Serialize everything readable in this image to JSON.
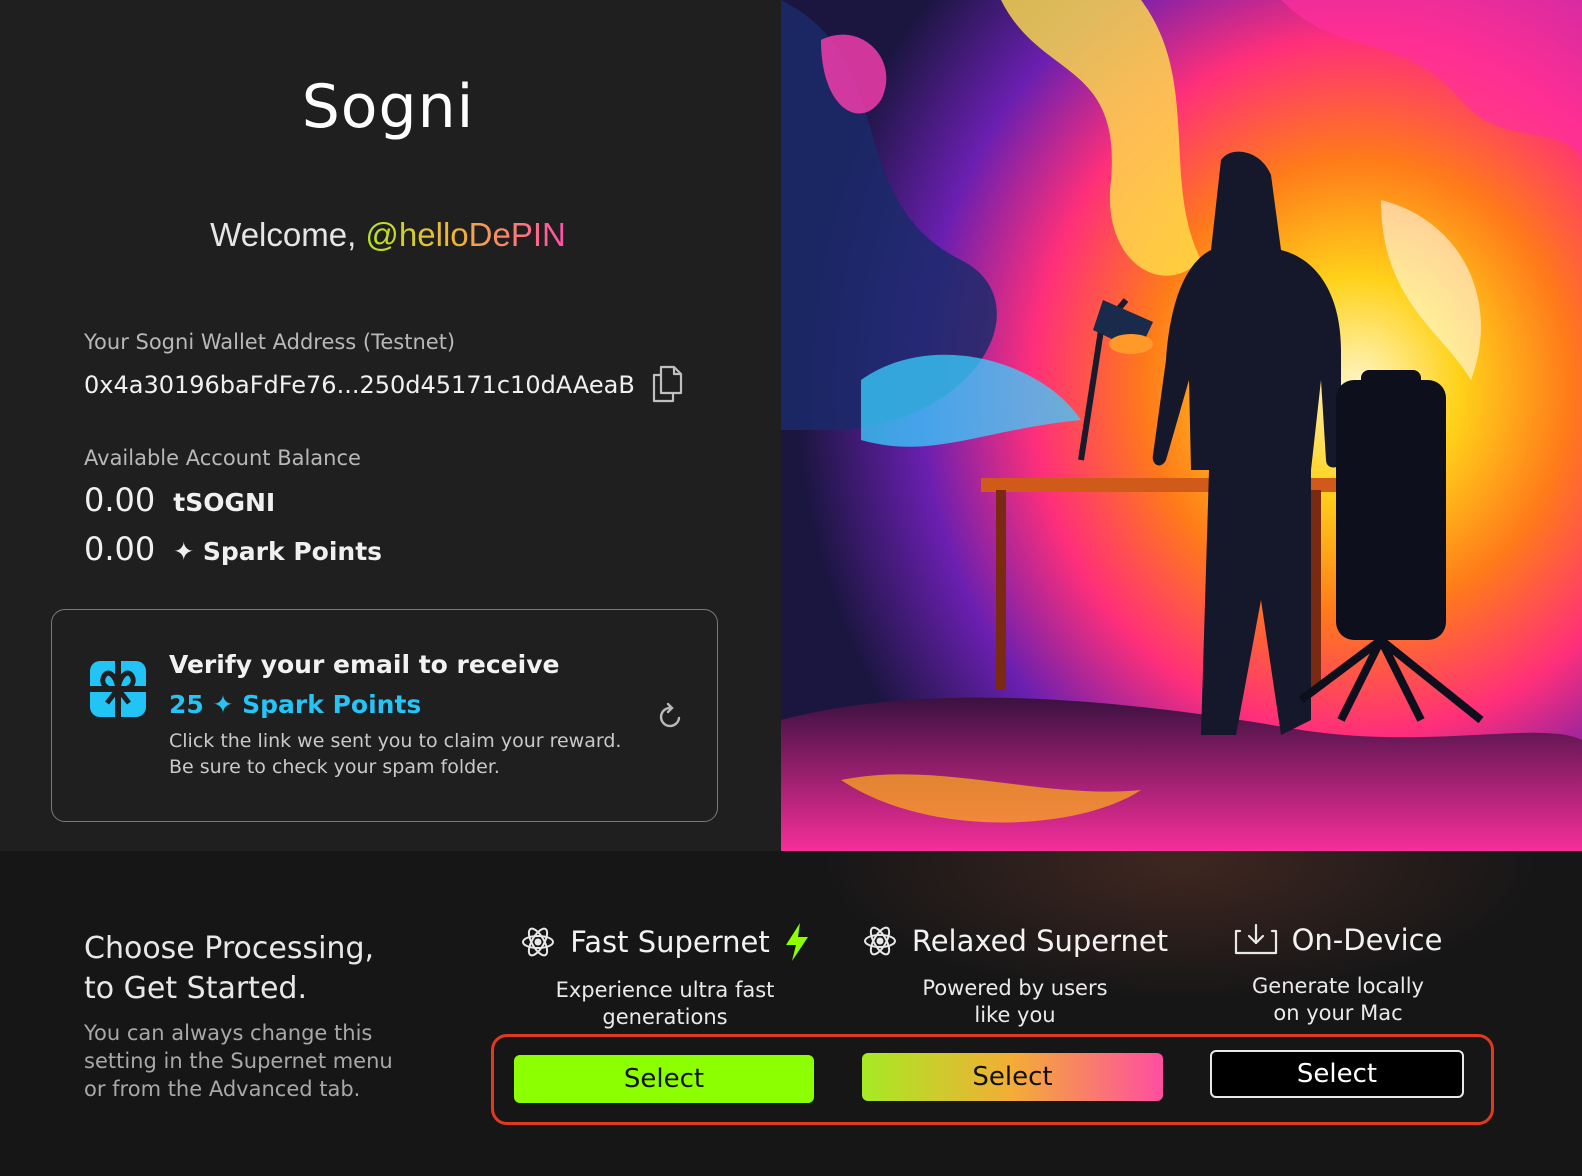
{
  "app": {
    "title": "Sogni"
  },
  "welcome": {
    "prefix": "Welcome, ",
    "username": "@helloDePIN"
  },
  "wallet": {
    "label": "Your Sogni Wallet Address (Testnet)",
    "address": "0x4a30196baFdFe76...250d45171c10dAAeaB",
    "copy_icon": "copy-icon"
  },
  "balance": {
    "label": "Available Account Balance",
    "token_amount": "0.00",
    "token_unit": "tSOGNI",
    "points_amount": "0.00",
    "points_unit": "✦ Spark Points"
  },
  "verify_card": {
    "icon": "gift-icon",
    "title": "Verify your email to receive",
    "points": "25 ✦ Spark Points",
    "desc_line1": "Click the link we sent you to claim your reward.",
    "desc_line2": "Be sure to check your spam folder.",
    "refresh_icon": "refresh-icon"
  },
  "processing": {
    "title_line1": "Choose Processing,",
    "title_line2": "to Get Started.",
    "note_line1": "You can always change this",
    "note_line2": "setting in the Supernet menu",
    "note_line3": "or from the Advanced tab.",
    "options": [
      {
        "title": "Fast Supernet",
        "desc_line1": "Experience ultra fast",
        "desc_line2": "generations",
        "button": "Select",
        "icon": "atom-icon",
        "badge_icon": "lightning-icon",
        "accent": "#8cff00"
      },
      {
        "title": "Relaxed Supernet",
        "desc_line1": "Powered by users",
        "desc_line2": "like you",
        "button": "Select",
        "icon": "atom-icon"
      },
      {
        "title": "On-Device",
        "desc_line1": "Generate locally",
        "desc_line2": "on your Mac",
        "button": "Select",
        "icon": "download-tray-icon"
      }
    ],
    "highlight_color": "#e03a1e"
  }
}
